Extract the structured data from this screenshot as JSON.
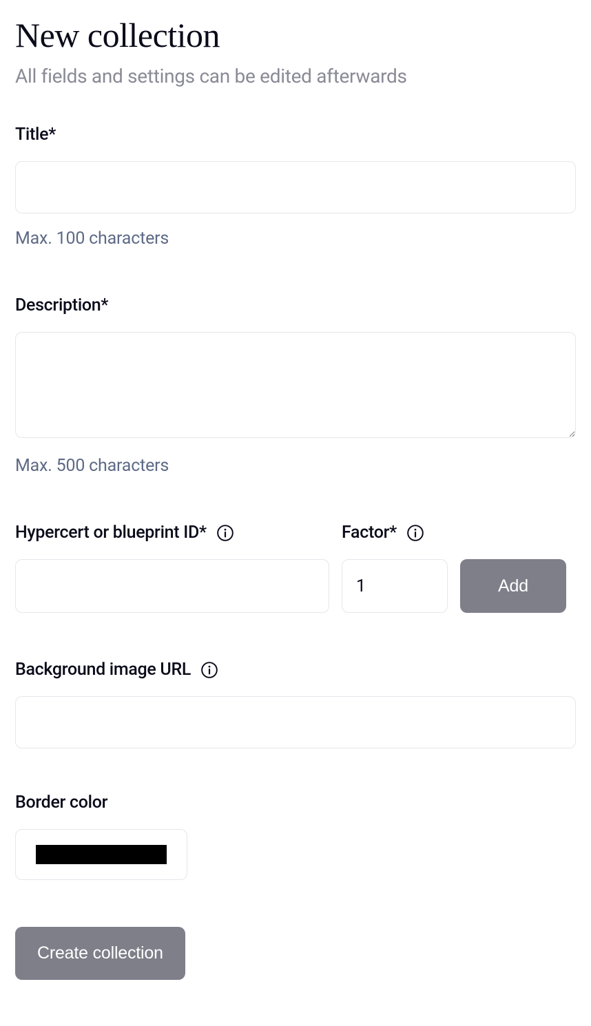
{
  "header": {
    "title": "New collection",
    "subtitle": "All fields and settings can be edited afterwards"
  },
  "fields": {
    "title": {
      "label": "Title*",
      "value": "",
      "helper": "Max. 100 characters"
    },
    "description": {
      "label": "Description*",
      "value": "",
      "helper": "Max. 500 characters"
    },
    "hypercert": {
      "label": "Hypercert or blueprint ID*",
      "value": ""
    },
    "factor": {
      "label": "Factor*",
      "value": "1"
    },
    "add_button_label": "Add",
    "background_url": {
      "label": "Background image URL",
      "value": ""
    },
    "border_color": {
      "label": "Border color",
      "value": "#000000"
    }
  },
  "submit_label": "Create collection"
}
